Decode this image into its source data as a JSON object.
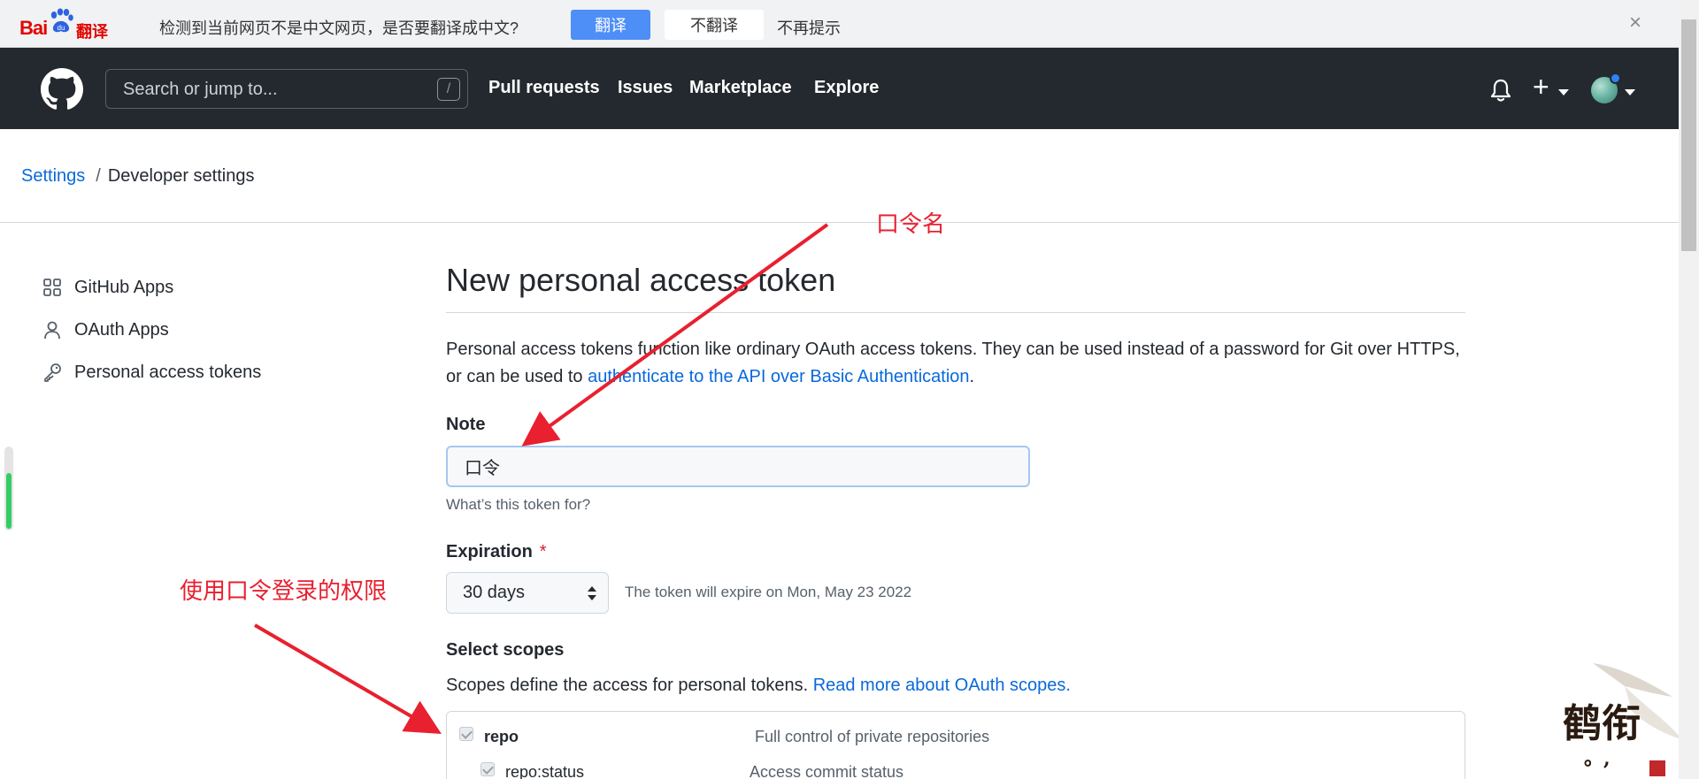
{
  "translate_bar": {
    "logo_text": "Bai",
    "logo_suffix": "翻译",
    "message": "检测到当前网页不是中文网页，是否要翻译成中文?",
    "translate_button": "翻译",
    "no_translate_button": "不翻译",
    "no_remind": "不再提示",
    "close": "×"
  },
  "header": {
    "search_placeholder": "Search or jump to...",
    "search_shortcut": "/",
    "nav": [
      "Pull requests",
      "Issues",
      "Marketplace",
      "Explore"
    ],
    "plus": "+"
  },
  "breadcrumb": {
    "settings": "Settings",
    "separator": "/",
    "current": "Developer settings"
  },
  "sidebar": {
    "items": [
      {
        "label": "GitHub Apps",
        "icon": "apps-grid-icon"
      },
      {
        "label": "OAuth Apps",
        "icon": "person-icon"
      },
      {
        "label": "Personal access tokens",
        "icon": "key-icon"
      }
    ]
  },
  "main": {
    "title": "New personal access token",
    "intro_text": "Personal access tokens function like ordinary OAuth access tokens. They can be used instead of a password for Git over HTTPS, or can be used to ",
    "intro_link": "authenticate to the API over Basic Authentication",
    "intro_end": ".",
    "note_label": "Note",
    "note_value": "口令",
    "note_hint": "What’s this token for?",
    "expiration_label": "Expiration",
    "expiration_required": "*",
    "expiration_value": "30 days",
    "expiration_note": "The token will expire on Mon, May 23 2022",
    "scopes_label": "Select scopes",
    "scopes_desc": "Scopes define the access for personal tokens. ",
    "scopes_link": "Read more about OAuth scopes.",
    "scopes": [
      {
        "name": "repo",
        "desc": "Full control of private repositories",
        "checked": true
      },
      {
        "name": "repo:status",
        "desc": "Access commit status",
        "checked": true
      }
    ]
  },
  "annotations": {
    "token_name": "口令名",
    "permissions": "使用口令登录的权限",
    "color": "#e8202f"
  },
  "watermark": {
    "main": "鹤衔",
    "sub": "。,"
  }
}
